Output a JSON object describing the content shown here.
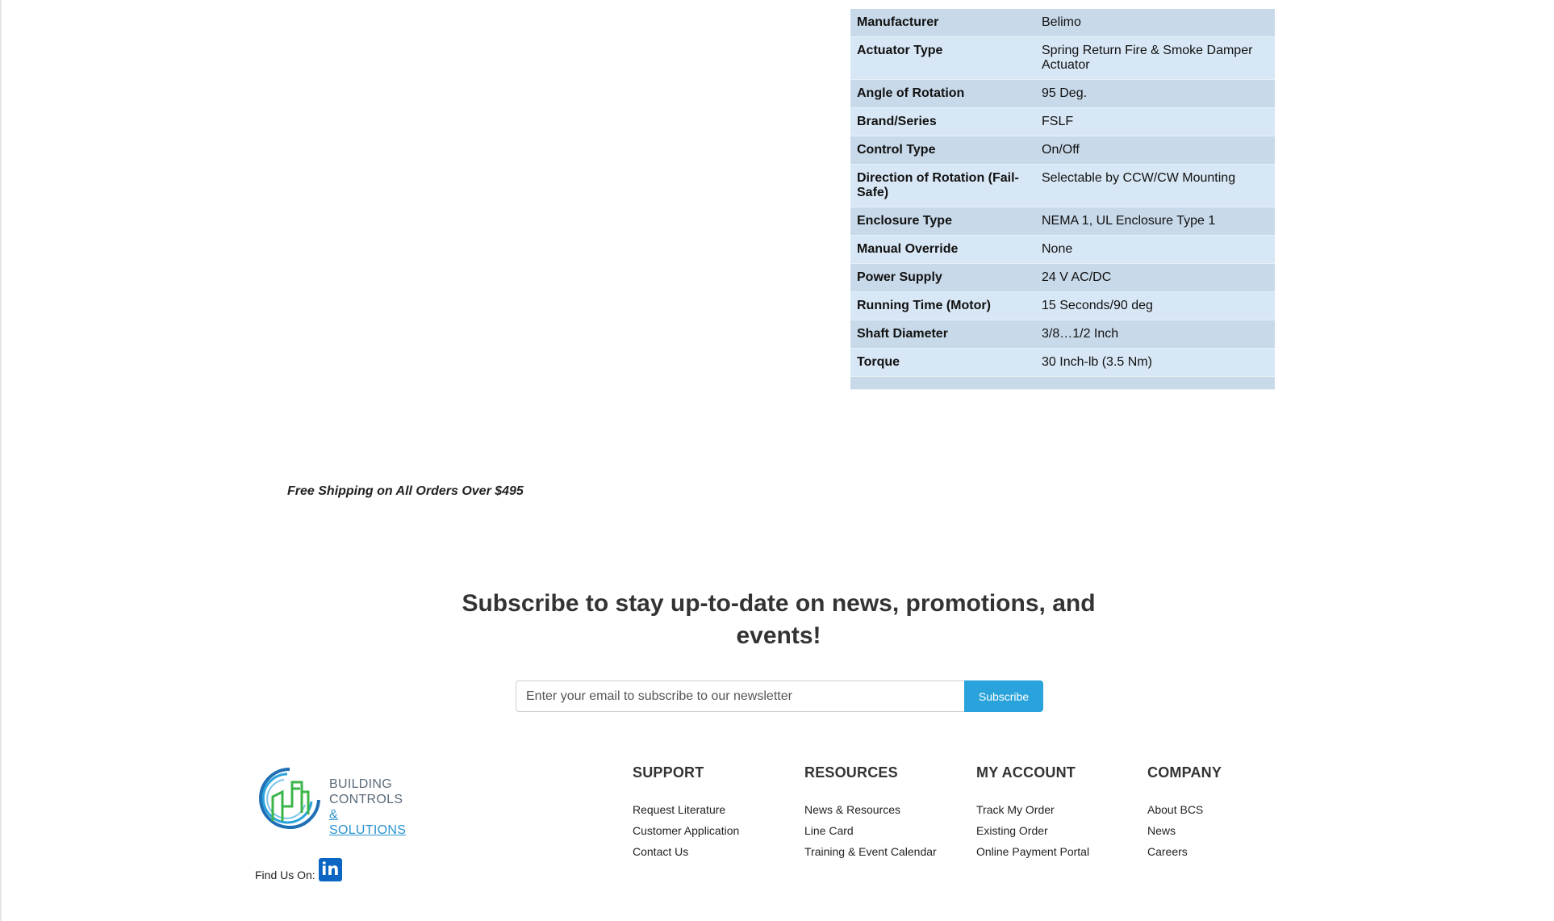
{
  "specs": [
    {
      "label": "Manufacturer",
      "value": "Belimo"
    },
    {
      "label": "Actuator Type",
      "value": "Spring Return Fire & Smoke Damper Actuator"
    },
    {
      "label": "Angle of Rotation",
      "value": "95 Deg."
    },
    {
      "label": "Brand/Series",
      "value": "FSLF"
    },
    {
      "label": "Control Type",
      "value": "On/Off"
    },
    {
      "label": "Direction of Rotation (Fail-Safe)",
      "value": "Selectable by CCW/CW Mounting"
    },
    {
      "label": "Enclosure Type",
      "value": "NEMA 1, UL Enclosure Type 1"
    },
    {
      "label": "Manual Override",
      "value": "None"
    },
    {
      "label": "Power Supply",
      "value": "24 V AC/DC"
    },
    {
      "label": "Running Time (Motor)",
      "value": "15 Seconds/90 deg"
    },
    {
      "label": "Shaft Diameter",
      "value": "3/8…1/2 Inch"
    },
    {
      "label": "Torque",
      "value": "30 Inch-lb (3.5 Nm)"
    }
  ],
  "shipping_note": "Free Shipping on All Orders Over $495",
  "subscribe": {
    "heading": "Subscribe to stay up-to-date on news, promotions, and events!",
    "placeholder": "Enter your email to subscribe to our newsletter",
    "button_label": "Subscribe"
  },
  "logo": {
    "line1": "BUILDING",
    "line2": "CONTROLS",
    "line3": "& SOLUTIONS"
  },
  "find_us_label": "Find Us On:",
  "linkedin_label": "in",
  "footer_columns": [
    {
      "title": "SUPPORT",
      "links": [
        "Request Literature",
        "Customer Application",
        "Contact Us"
      ]
    },
    {
      "title": "RESOURCES",
      "links": [
        "News & Resources",
        "Line Card",
        "Training & Event Calendar"
      ]
    },
    {
      "title": "MY ACCOUNT",
      "links": [
        "Track My Order",
        "Existing Order",
        "Online Payment Portal"
      ]
    },
    {
      "title": "COMPANY",
      "links": [
        "About BCS",
        "News",
        "Careers"
      ]
    }
  ],
  "colors": {
    "row_dark": "#c8d9e9",
    "row_light": "#d8e7f5",
    "subscribe_button": "#2aa3dc",
    "linkedin": "#0a66c2"
  }
}
